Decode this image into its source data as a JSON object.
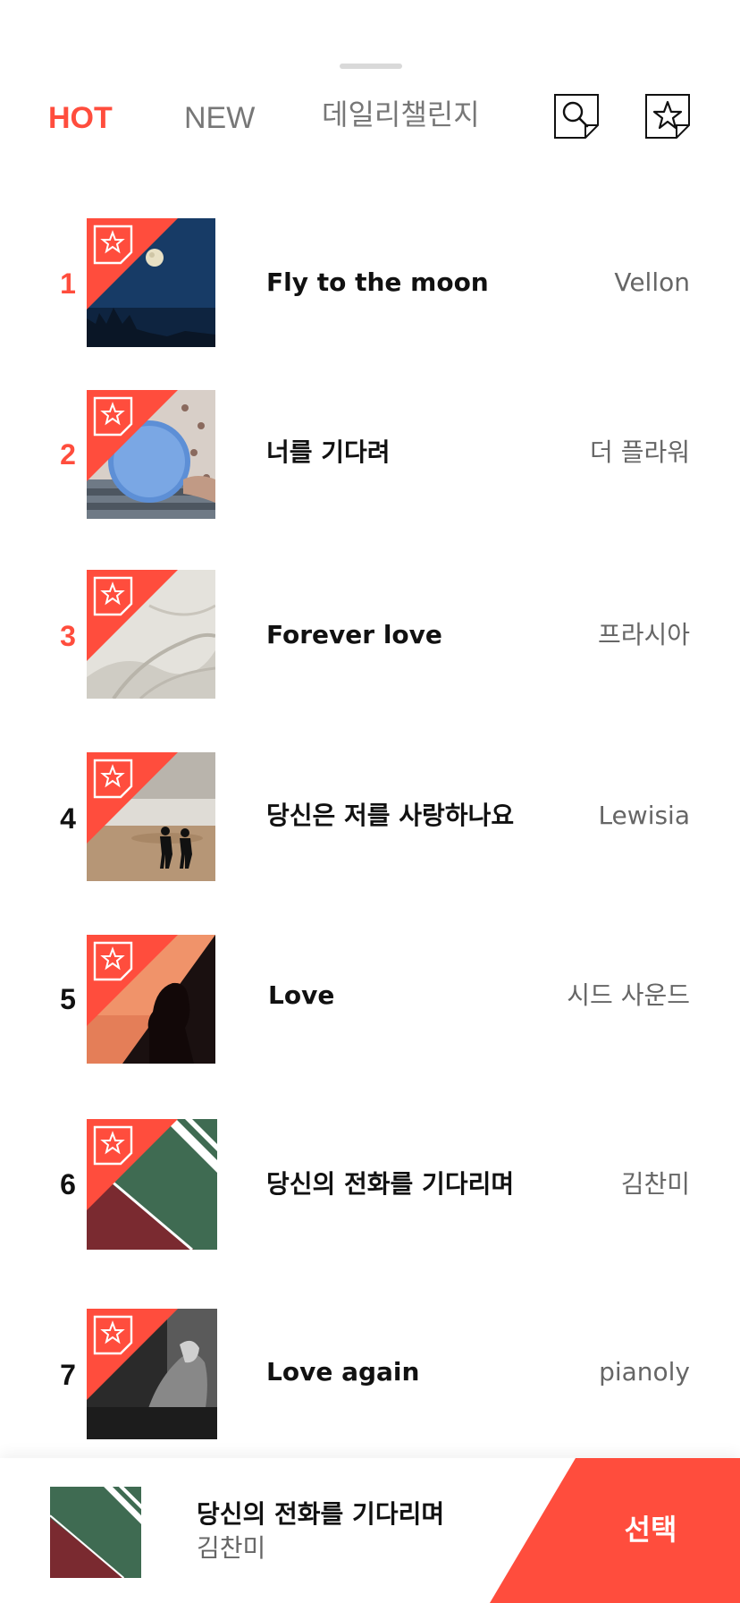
{
  "tabs": {
    "hot": "HOT",
    "new": "NEW",
    "daily": "데일리챌린지"
  },
  "icons": {
    "search": "search-icon",
    "favorites": "star-tag-icon",
    "thumb_badge": "star-tag-icon"
  },
  "colors": {
    "accent": "#ff4d3d",
    "text": "#111111",
    "muted": "#666666"
  },
  "songs": [
    {
      "rank": "1",
      "title": "Fly to the moon",
      "artist": "Vellon",
      "art": "night-sky-moon"
    },
    {
      "rank": "2",
      "title": "너를 기다려",
      "artist": "더 플라워",
      "art": "mirror-sky"
    },
    {
      "rank": "3",
      "title": "Forever love",
      "artist": "프라시아",
      "art": "white-sheets"
    },
    {
      "rank": "4",
      "title": "당신은 저를 사랑하나요",
      "artist": "Lewisia",
      "art": "couple-beach"
    },
    {
      "rank": "5",
      "title": "Love",
      "artist": "시드 사운드",
      "art": "sunset-silhouette"
    },
    {
      "rank": "6",
      "title": "당신의 전화를 기다리며",
      "artist": "김찬미",
      "art": "green-red-diagonal"
    },
    {
      "rank": "7",
      "title": "Love again",
      "artist": "pianoly",
      "art": "bw-portrait"
    }
  ],
  "player": {
    "title": "당신의 전화를 기다리며",
    "artist": "김찬미",
    "select_label": "선택"
  }
}
